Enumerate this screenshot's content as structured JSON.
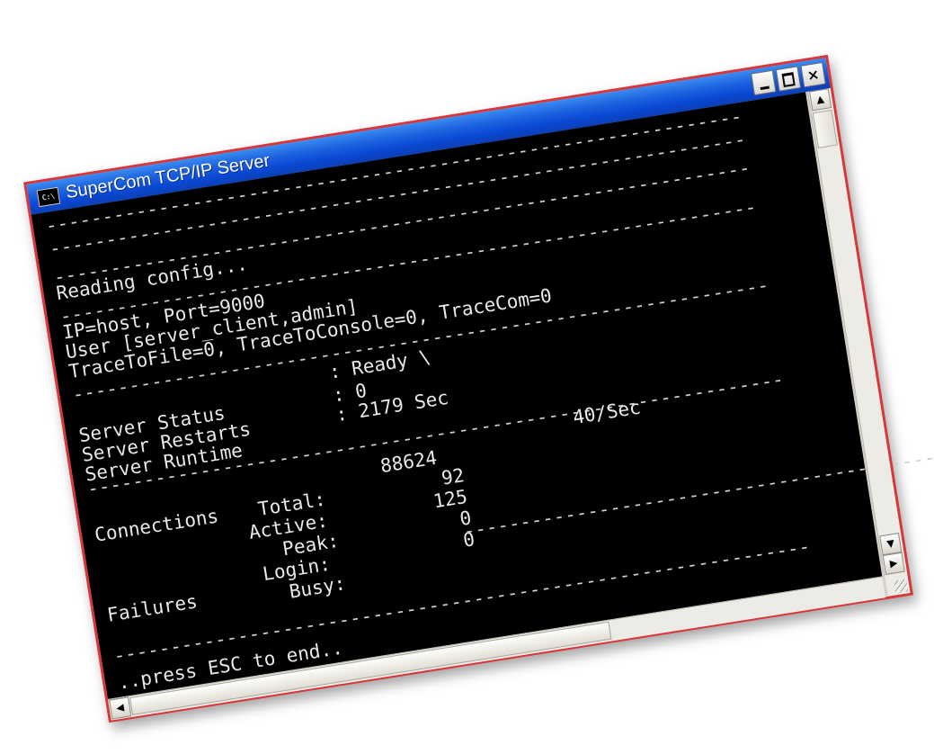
{
  "window": {
    "title": "SuperCom TCP/IP Server",
    "icon_text": "C:\\",
    "icon_name": "console-icon",
    "controls": {
      "minimize": "minimize-icon",
      "maximize": "maximize-icon",
      "close": "×"
    }
  },
  "console": {
    "separator": "--------------------------------------------------------------",
    "reading": "Reading config...",
    "ip_line": "IP=host, Port=9000",
    "user_line": "User [server_client,admin]",
    "trace_line": "TraceToFile=0, TraceToConsole=0, TraceCom=0",
    "status": {
      "label_status": "Server Status",
      "label_restarts": "Server Restarts",
      "label_runtime": "Server Runtime",
      "value_status": ": Ready \\",
      "value_restarts": ": 0",
      "value_runtime": ": 2179 Sec"
    },
    "connections": {
      "rate": "40/Sec",
      "label_group": "Connections",
      "label_total": "Total:",
      "label_active": "Active:",
      "label_peak": "Peak:",
      "value_total": "88624",
      "value_active": "92",
      "value_peak": "125"
    },
    "failures": {
      "label_group": "Failures",
      "label_login": "Login:",
      "label_busy": "Busy:",
      "value_login": "0",
      "value_busy": "0"
    },
    "footer": "..press ESC to end.."
  },
  "scrollbars": {
    "up_arrow": "▲",
    "down_arrow": "▼",
    "left_arrow": "◀",
    "right_arrow": "▶"
  },
  "colors": {
    "titlebar": "#0a49d4",
    "frame_border": "#d8363a",
    "console_bg": "#000000",
    "console_text": "#e8e8e8"
  }
}
